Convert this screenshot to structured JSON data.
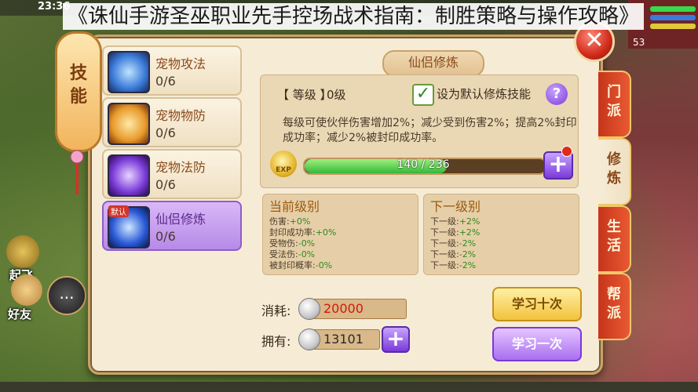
{
  "hud": {
    "clock": "23:36",
    "title_overlay": "《诛仙手游圣巫职业先手控场战术指南：制胜策略与操作攻略》",
    "level_num": "53",
    "fly_label": "起飞",
    "friend_label": "好友",
    "bubble_label": "...",
    "bar_colors": [
      "#3ad84a",
      "#3a7ad8",
      "#e0c83a"
    ]
  },
  "skill_tag": [
    "技",
    "能"
  ],
  "skills": [
    {
      "name": "宠物攻法",
      "count": "0/6",
      "icon_color": "#3a7ad8"
    },
    {
      "name": "宠物物防",
      "count": "0/6",
      "icon_color": "#e89a2a"
    },
    {
      "name": "宠物法防",
      "count": "0/6",
      "icon_color": "#7a3ad8"
    },
    {
      "name": "仙侣修炼",
      "count": "0/6",
      "icon_color": "#2a5ad8",
      "badge": "默认"
    }
  ],
  "main": {
    "section_title": "仙侣修炼",
    "level_label": "【 等级 】",
    "level_value": "0级",
    "checkbox_mark": "✓",
    "default_label": "设为默认修炼技能",
    "help_symbol": "?",
    "description": "每级可使伙伴伤害增加2%；减少受到伤害2%；提高2%封印成功率；减少2%被封印成功率。",
    "exp_icon_text": "EXP",
    "exp_text": "140 / 236",
    "exp_fraction": 0.593,
    "plus": "+",
    "close": "✕"
  },
  "current_level": {
    "title": "当前级别",
    "stats": [
      {
        "label": "伤害:",
        "value": "+0%"
      },
      {
        "label": "封印成功率:",
        "value": "+0%"
      },
      {
        "label": "受物伤:",
        "value": "-0%"
      },
      {
        "label": "受法伤:",
        "value": "-0%"
      },
      {
        "label": "被封印概率:",
        "value": "-0%"
      }
    ]
  },
  "next_level": {
    "title": "下一级别",
    "stats": [
      {
        "label": "下一级:",
        "value": "+2%"
      },
      {
        "label": "下一级:",
        "value": "+2%"
      },
      {
        "label": "下一级:",
        "value": "-2%"
      },
      {
        "label": "下一级:",
        "value": "-2%"
      },
      {
        "label": "下一级:",
        "value": "-2%"
      }
    ]
  },
  "cost": {
    "label": "消耗:",
    "value": "20000"
  },
  "owned": {
    "label": "拥有:",
    "value": "13101"
  },
  "buttons": {
    "learn_ten": "学习十次",
    "learn_one": "学习一次"
  },
  "tabs": [
    {
      "chars": [
        "门",
        "派"
      ],
      "active": false
    },
    {
      "chars": [
        "修",
        "炼"
      ],
      "active": true
    },
    {
      "chars": [
        "生",
        "活"
      ],
      "active": false
    },
    {
      "chars": [
        "帮",
        "派"
      ],
      "active": false
    }
  ]
}
